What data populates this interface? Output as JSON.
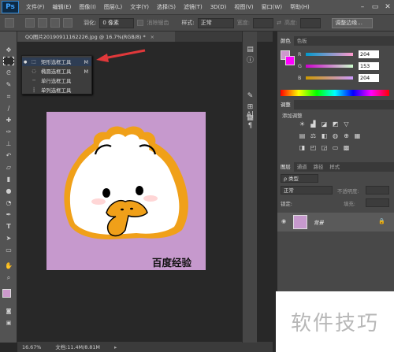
{
  "menubar": {
    "logo": "Ps",
    "items": [
      "文件(F)",
      "编辑(E)",
      "图像(I)",
      "图层(L)",
      "文字(Y)",
      "选择(S)",
      "滤镜(T)",
      "3D(D)",
      "视图(V)",
      "窗口(W)",
      "帮助(H)"
    ],
    "minimize_icon": "minimize-icon",
    "maximize_icon": "maximize-icon",
    "close_icon": "close-icon"
  },
  "options_bar": {
    "feather_label": "羽化:",
    "feather_value": "0 像素",
    "antialias_label": "消除锯齿",
    "style_label": "样式:",
    "style_value": "正常",
    "width_label": "宽度:",
    "height_label": "高度:",
    "refine_edge_button": "调整边缘..."
  },
  "document": {
    "tab_title": "QQ图片20190911162226.jpg @ 16.7%(RGB/8) *",
    "tab_close": "×",
    "zoom": "16.67%",
    "doc_size": "文档:11.4M/8.81M"
  },
  "flyout": {
    "items": [
      {
        "label": "矩形选框工具",
        "shortcut": "M"
      },
      {
        "label": "椭圆选框工具",
        "shortcut": "M"
      },
      {
        "label": "单行选框工具",
        "shortcut": ""
      },
      {
        "label": "单列选框工具",
        "shortcut": ""
      }
    ]
  },
  "canvas": {
    "caption": "百度经验",
    "background_color": "#c699cd"
  },
  "color_panel": {
    "tabs": [
      "颜色",
      "色板"
    ],
    "r_label": "R",
    "g_label": "G",
    "b_label": "B",
    "r_value": "204",
    "g_value": "153",
    "b_value": "204",
    "foreground_color": "#cc99cc"
  },
  "adjustments_panel": {
    "tab": "调整",
    "title": "添加调整"
  },
  "layers_panel": {
    "tabs": [
      "图层",
      "通道",
      "路径",
      "样式"
    ],
    "filter_label": "ρ 类型",
    "blend_mode": "正常",
    "opacity_label": "不透明度:",
    "lock_label": "锁定:",
    "fill_label": "填充:",
    "layer_name": "背景"
  },
  "watermark": {
    "text": "软件技巧"
  },
  "colors": {
    "arrow": "#e0383a",
    "accent": "#cc99cc"
  }
}
